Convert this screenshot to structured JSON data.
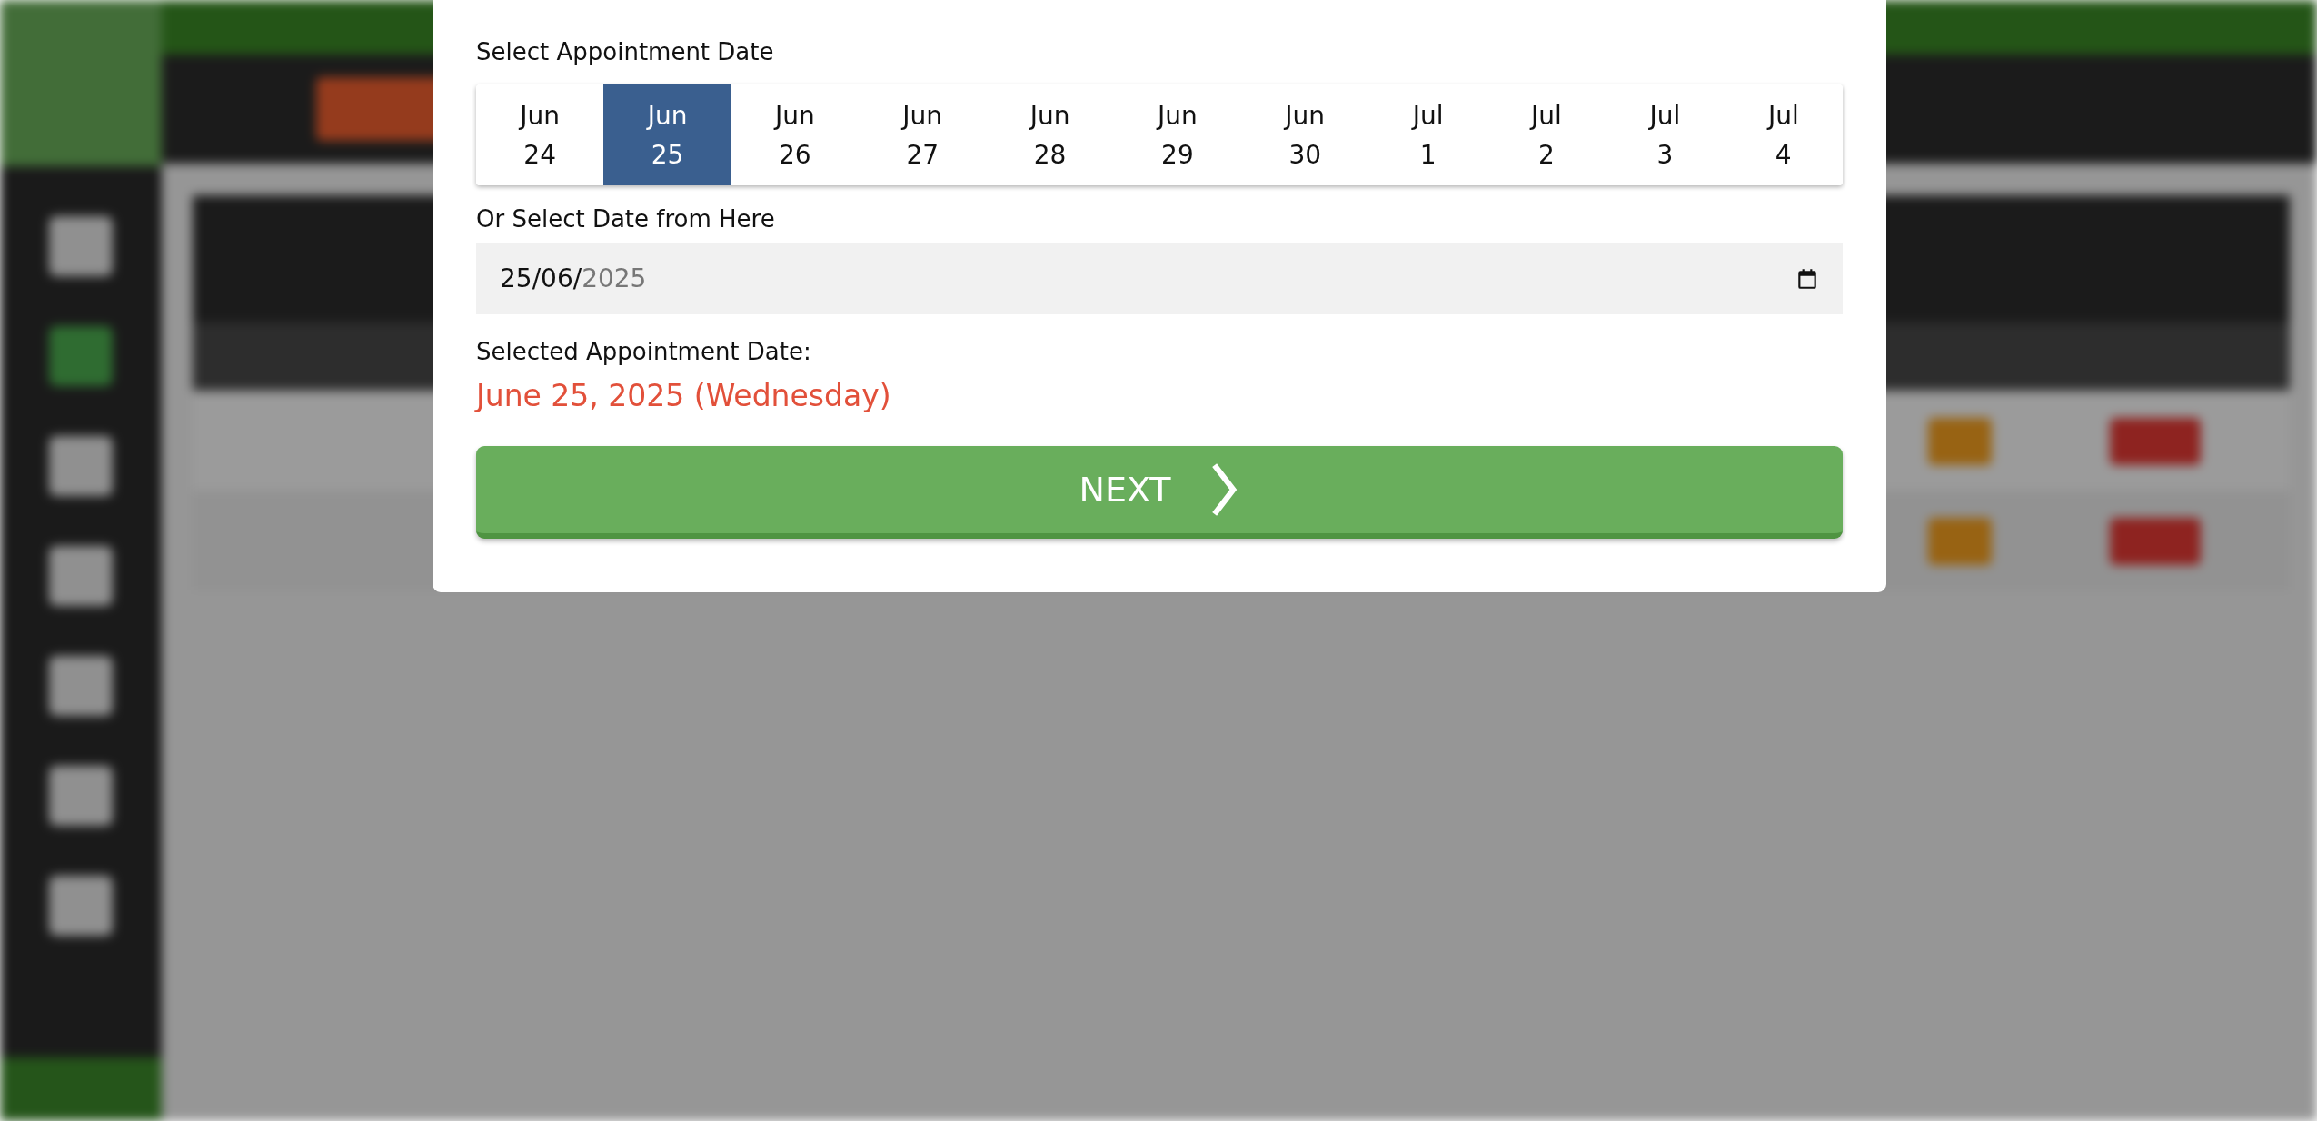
{
  "modal": {
    "title": "Select Appointment Date",
    "dates": [
      {
        "month": "Jun",
        "day": "24",
        "selected": false
      },
      {
        "month": "Jun",
        "day": "25",
        "selected": true
      },
      {
        "month": "Jun",
        "day": "26",
        "selected": false
      },
      {
        "month": "Jun",
        "day": "27",
        "selected": false
      },
      {
        "month": "Jun",
        "day": "28",
        "selected": false
      },
      {
        "month": "Jun",
        "day": "29",
        "selected": false
      },
      {
        "month": "Jun",
        "day": "30",
        "selected": false
      },
      {
        "month": "Jul",
        "day": "1",
        "selected": false
      },
      {
        "month": "Jul",
        "day": "2",
        "selected": false
      },
      {
        "month": "Jul",
        "day": "3",
        "selected": false
      },
      {
        "month": "Jul",
        "day": "4",
        "selected": false
      }
    ],
    "date_field": {
      "label": "Or Select Date from Here",
      "value": "25/06/2025"
    },
    "selected_label": "Selected Appointment Date:",
    "selected_date": "June 25, 2025 (Wednesday)",
    "next_button": "NEXT"
  }
}
